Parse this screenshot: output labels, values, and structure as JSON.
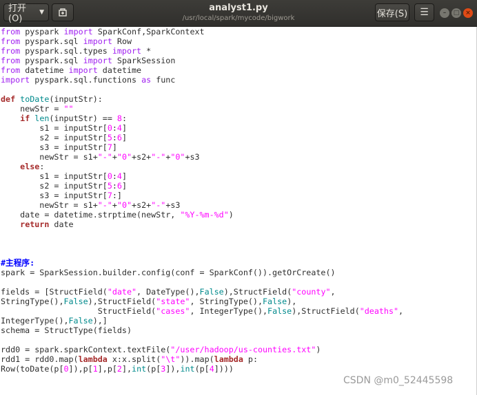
{
  "header": {
    "open_label": "打开(O)",
    "title": "analyst1.py",
    "path": "/usr/local/spark/mycode/bigwork",
    "save_label": "保存(S)"
  },
  "editor": {
    "lines": [
      [
        [
          "kw",
          "from"
        ],
        [
          "plain",
          " pyspark "
        ],
        [
          "kw",
          "import"
        ],
        [
          "plain",
          " SparkConf,SparkContext"
        ]
      ],
      [
        [
          "kw",
          "from"
        ],
        [
          "plain",
          " pyspark.sql "
        ],
        [
          "kw",
          "import"
        ],
        [
          "plain",
          " Row"
        ]
      ],
      [
        [
          "kw",
          "from"
        ],
        [
          "plain",
          " pyspark.sql.types "
        ],
        [
          "kw",
          "import"
        ],
        [
          "plain",
          " *"
        ]
      ],
      [
        [
          "kw",
          "from"
        ],
        [
          "plain",
          " pyspark.sql "
        ],
        [
          "kw",
          "import"
        ],
        [
          "plain",
          " SparkSession"
        ]
      ],
      [
        [
          "kw",
          "from"
        ],
        [
          "plain",
          " datetime "
        ],
        [
          "kw",
          "import"
        ],
        [
          "plain",
          " datetime"
        ]
      ],
      [
        [
          "kw",
          "import"
        ],
        [
          "plain",
          " pyspark.sql.functions "
        ],
        [
          "kw",
          "as"
        ],
        [
          "plain",
          " func"
        ]
      ],
      [],
      [
        [
          "def",
          "def"
        ],
        [
          "plain",
          " "
        ],
        [
          "fn",
          "toDate"
        ],
        [
          "plain",
          "(inputStr):"
        ]
      ],
      [
        [
          "plain",
          "    newStr = "
        ],
        [
          "str",
          "\"\""
        ]
      ],
      [
        [
          "plain",
          "    "
        ],
        [
          "def",
          "if"
        ],
        [
          "plain",
          " "
        ],
        [
          "fn",
          "len"
        ],
        [
          "plain",
          "(inputStr) == "
        ],
        [
          "num",
          "8"
        ],
        [
          "plain",
          ":"
        ]
      ],
      [
        [
          "plain",
          "        s1 = inputStr["
        ],
        [
          "num",
          "0"
        ],
        [
          "plain",
          ":"
        ],
        [
          "num",
          "4"
        ],
        [
          "plain",
          "]"
        ]
      ],
      [
        [
          "plain",
          "        s2 = inputStr["
        ],
        [
          "num",
          "5"
        ],
        [
          "plain",
          ":"
        ],
        [
          "num",
          "6"
        ],
        [
          "plain",
          "]"
        ]
      ],
      [
        [
          "plain",
          "        s3 = inputStr["
        ],
        [
          "num",
          "7"
        ],
        [
          "plain",
          "]"
        ]
      ],
      [
        [
          "plain",
          "        newStr = s1+"
        ],
        [
          "str",
          "\"-\""
        ],
        [
          "plain",
          "+"
        ],
        [
          "str",
          "\"0\""
        ],
        [
          "plain",
          "+s2+"
        ],
        [
          "str",
          "\"-\""
        ],
        [
          "plain",
          "+"
        ],
        [
          "str",
          "\"0\""
        ],
        [
          "plain",
          "+s3"
        ]
      ],
      [
        [
          "plain",
          "    "
        ],
        [
          "def",
          "else"
        ],
        [
          "plain",
          ":"
        ]
      ],
      [
        [
          "plain",
          "        s1 = inputStr["
        ],
        [
          "num",
          "0"
        ],
        [
          "plain",
          ":"
        ],
        [
          "num",
          "4"
        ],
        [
          "plain",
          "]"
        ]
      ],
      [
        [
          "plain",
          "        s2 = inputStr["
        ],
        [
          "num",
          "5"
        ],
        [
          "plain",
          ":"
        ],
        [
          "num",
          "6"
        ],
        [
          "plain",
          "]"
        ]
      ],
      [
        [
          "plain",
          "        s3 = inputStr["
        ],
        [
          "num",
          "7"
        ],
        [
          "plain",
          ":]"
        ]
      ],
      [
        [
          "plain",
          "        newStr = s1+"
        ],
        [
          "str",
          "\"-\""
        ],
        [
          "plain",
          "+"
        ],
        [
          "str",
          "\"0\""
        ],
        [
          "plain",
          "+s2+"
        ],
        [
          "str",
          "\"-\""
        ],
        [
          "plain",
          "+s3"
        ]
      ],
      [
        [
          "plain",
          "    date = datetime.strptime(newStr, "
        ],
        [
          "str",
          "\"%Y-%m-%d\""
        ],
        [
          "plain",
          ")"
        ]
      ],
      [
        [
          "plain",
          "    "
        ],
        [
          "def",
          "return"
        ],
        [
          "plain",
          " date"
        ]
      ],
      [],
      [],
      [],
      [
        [
          "comment",
          "#主程序:"
        ]
      ],
      [
        [
          "plain",
          "spark = SparkSession.builder.config(conf = SparkConf()).getOrCreate()"
        ]
      ],
      [],
      [
        [
          "plain",
          "fields = [StructField("
        ],
        [
          "str",
          "\"date\""
        ],
        [
          "plain",
          ", DateType(),"
        ],
        [
          "fn",
          "False"
        ],
        [
          "plain",
          "),StructField("
        ],
        [
          "str",
          "\"county\""
        ],
        [
          "plain",
          ","
        ]
      ],
      [
        [
          "plain",
          "StringType(),"
        ],
        [
          "fn",
          "False"
        ],
        [
          "plain",
          "),StructField("
        ],
        [
          "str",
          "\"state\""
        ],
        [
          "plain",
          ", StringType(),"
        ],
        [
          "fn",
          "False"
        ],
        [
          "plain",
          "),"
        ]
      ],
      [
        [
          "plain",
          "                    StructField("
        ],
        [
          "str",
          "\"cases\""
        ],
        [
          "plain",
          ", IntegerType(),"
        ],
        [
          "fn",
          "False"
        ],
        [
          "plain",
          "),StructField("
        ],
        [
          "str",
          "\"deaths\""
        ],
        [
          "plain",
          ","
        ]
      ],
      [
        [
          "plain",
          "IntegerType(),"
        ],
        [
          "fn",
          "False"
        ],
        [
          "plain",
          "),]"
        ]
      ],
      [
        [
          "plain",
          "schema = StructType(fields)"
        ]
      ],
      [],
      [
        [
          "plain",
          "rdd0 = spark.sparkContext.textFile("
        ],
        [
          "str",
          "\"/user/hadoop/us-counties.txt\""
        ],
        [
          "plain",
          ")"
        ]
      ],
      [
        [
          "plain",
          "rdd1 = rdd0.map("
        ],
        [
          "def",
          "lambda"
        ],
        [
          "plain",
          " x:x.split("
        ],
        [
          "str",
          "\"\\t\""
        ],
        [
          "plain",
          ")).map("
        ],
        [
          "def",
          "lambda"
        ],
        [
          "plain",
          " p:"
        ]
      ],
      [
        [
          "plain",
          "Row(toDate(p["
        ],
        [
          "num",
          "0"
        ],
        [
          "plain",
          "]),p["
        ],
        [
          "num",
          "1"
        ],
        [
          "plain",
          "],p["
        ],
        [
          "num",
          "2"
        ],
        [
          "plain",
          "],"
        ],
        [
          "fn",
          "int"
        ],
        [
          "plain",
          "(p["
        ],
        [
          "num",
          "3"
        ],
        [
          "plain",
          "]),"
        ],
        [
          "fn",
          "int"
        ],
        [
          "plain",
          "(p["
        ],
        [
          "num",
          "4"
        ],
        [
          "plain",
          "])))"
        ]
      ]
    ]
  },
  "watermark": "CSDN @m0_52445598",
  "colors": {
    "keyword": "#a52a2a",
    "import": "#a020f0",
    "builtin": "#008a8c",
    "string": "#ff00ff",
    "comment": "#0000ff",
    "close": "#df4a16"
  }
}
